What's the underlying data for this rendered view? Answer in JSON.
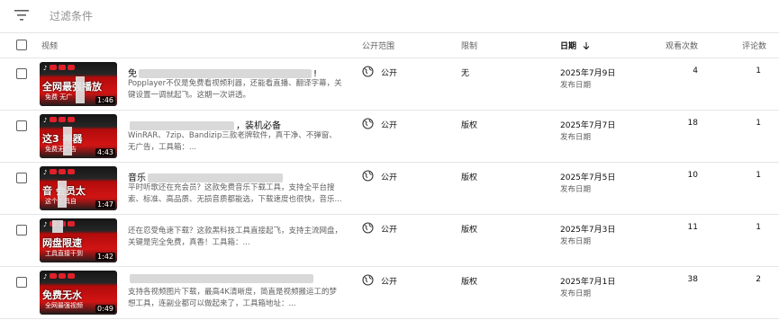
{
  "filter": {
    "placeholder": "过滤条件",
    "icon": "filter-icon"
  },
  "table": {
    "headers": {
      "video": "视频",
      "visibility": "公开范围",
      "restrictions": "限制",
      "date": "日期",
      "date_sort_icon": "arrow-down-icon",
      "views": "观看次数",
      "comments": "评论数"
    },
    "rows": [
      {
        "thumb_main": "全网最强播放",
        "thumb_sub": "免费    无广",
        "duration": "1:46",
        "title_prefix": "免",
        "title_suffix": "!",
        "description": "Popplayer不仅是免费看视频利器，还能看直播、翻译字幕，关键设置一调就起飞。这期一次讲透。",
        "visibility": "公开",
        "restriction": "无",
        "date": "2025年7月9日",
        "date_label": "发布日期",
        "views": "4",
        "comments": "1"
      },
      {
        "thumb_main": "这3    神器",
        "thumb_sub": "免费无广告",
        "duration": "4:43",
        "title_prefix": "",
        "title_suffix": "，装机必备",
        "description": "WinRAR、7zip、Bandizip三款老牌软件，真干净、不弹窗、无广告，工具箱：...",
        "visibility": "公开",
        "restriction": "版权",
        "date": "2025年7月7日",
        "date_label": "发布日期",
        "views": "18",
        "comments": "1"
      },
      {
        "thumb_main": "音    会员太",
        "thumb_sub": "这个工具自",
        "duration": "1:47",
        "title_prefix": "音乐",
        "title_suffix": "",
        "description": "平时听歌还在充会员？这款免费音乐下载工具，支持全平台搜索、标准、高品质、无损音质都能选，下载速度也很快，音乐...",
        "visibility": "公开",
        "restriction": "版权",
        "date": "2025年7月5日",
        "date_label": "发布日期",
        "views": "10",
        "comments": "1"
      },
      {
        "thumb_main": "网盘限速",
        "thumb_sub": "工具直接干到",
        "duration": "1:42",
        "title_prefix": "",
        "title_suffix": "",
        "description": "还在忍受龟速下载？这款黑科技工具直接起飞，支持主流网盘，关键是完全免费，真香！工具箱：...",
        "visibility": "公开",
        "restriction": "版权",
        "date": "2025年7月3日",
        "date_label": "发布日期",
        "views": "11",
        "comments": "1"
      },
      {
        "thumb_main": "免费无水",
        "thumb_sub": "全网最强视频",
        "duration": "0:49",
        "title_prefix": "",
        "title_suffix": "",
        "description": "支持各视频图片下载，最高4K清晰度，简直是视频搬运工的梦想工具，连副业都可以做起来了，工具箱地址：...",
        "visibility": "公开",
        "restriction": "版权",
        "date": "2025年7月1日",
        "date_label": "发布日期",
        "views": "38",
        "comments": "2"
      }
    ]
  }
}
